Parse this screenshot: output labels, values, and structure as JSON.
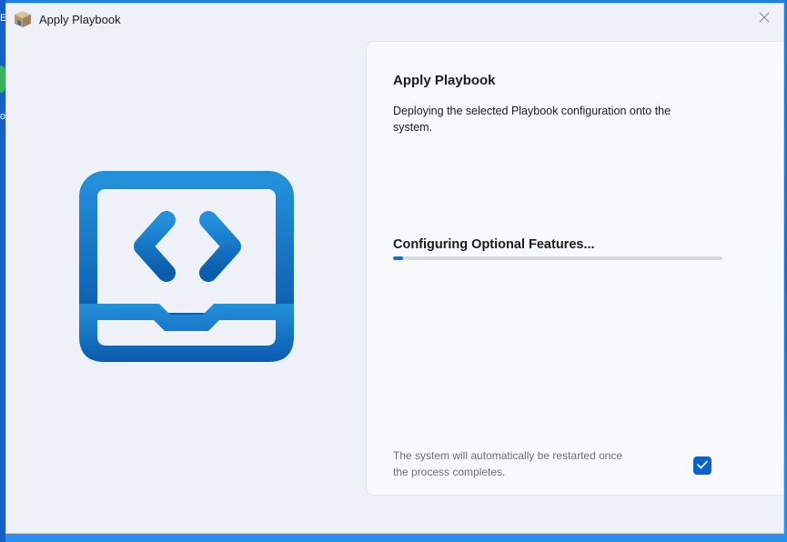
{
  "window": {
    "title": "Apply Playbook",
    "app_icon": "cardboard-box-icon",
    "close_icon": "close-icon"
  },
  "hero": {
    "icon": "laptop-code-icon",
    "color_top": "#2390dc",
    "color_bottom": "#0b5cad"
  },
  "card": {
    "title": "Apply Playbook",
    "description": "Deploying the selected Playbook configuration onto the system.",
    "status": "Configuring Optional Features...",
    "progress_fraction": 0.03,
    "restart_note": "The system will automatically be restarted once the process completes.",
    "restart_checked": true
  },
  "colors": {
    "accent": "#0a63c4",
    "window_bg": "#eef1f7",
    "card_bg": "#f7f9fc"
  }
}
